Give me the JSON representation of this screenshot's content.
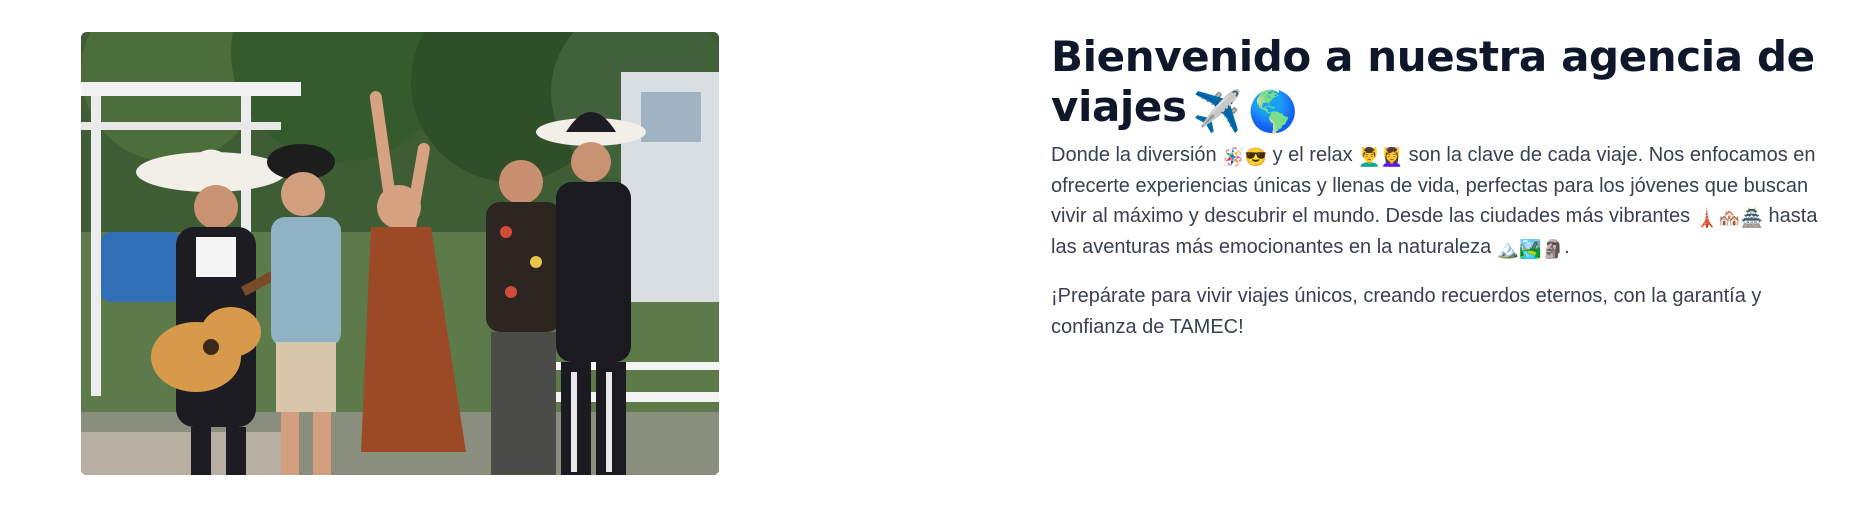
{
  "hero": {
    "image_alt": "Grupo de jóvenes bailando con mariachis tocando la guitarra en un jardín",
    "title_text": "Bienvenido a nuestra agencia de viajes",
    "title_emojis": [
      "✈️",
      "🌎"
    ],
    "paragraph1": {
      "part1": "Donde la diversión ",
      "emoji1": "🪅😎",
      "part2": " y el relax ",
      "emoji2": "💆‍♂️💆‍♀️",
      "part3": " son la clave de cada viaje. Nos enfocamos en ofrecerte experiencias únicas y llenas de vida, perfectas para los jóvenes que buscan vivir al máximo y descubrir el mundo. Desde las ciudades más vibrantes ",
      "emoji3": "🗼🏘️🏯",
      "part4": " hasta las aventuras más emocionantes en la naturaleza ",
      "emoji4": "🏔️🏞️🗿",
      "part5": "."
    },
    "paragraph2": "¡Prepárate para vivir viajes únicos, creando recuerdos eternos, con la garantía y confianza de TAMEC!"
  }
}
